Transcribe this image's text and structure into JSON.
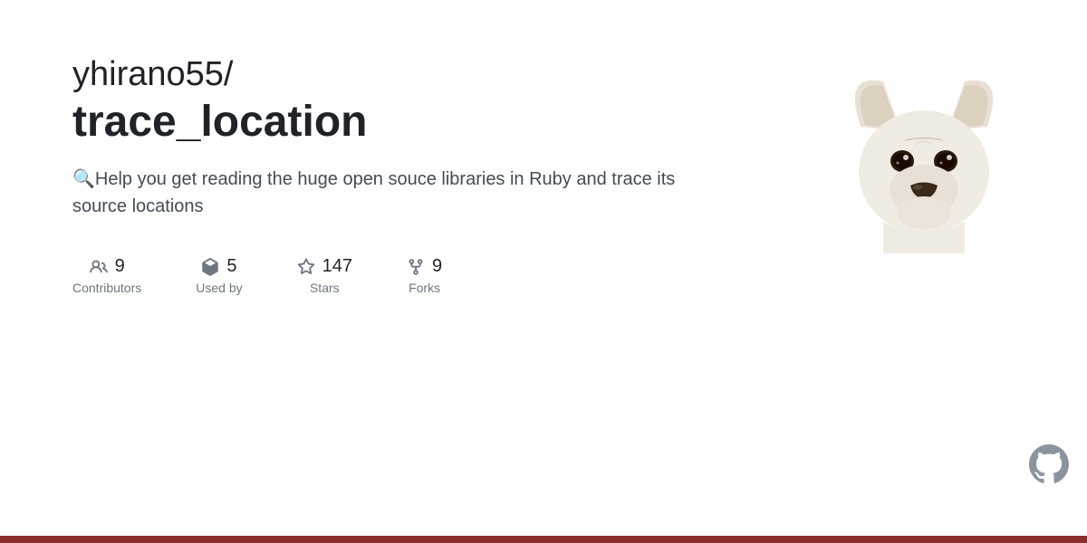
{
  "repo": {
    "owner": "yhirano55/",
    "name": "trace_location",
    "description": "🔍Help you get reading the huge open souce libraries in Ruby and trace its source locations"
  },
  "stats": [
    {
      "id": "contributors",
      "icon": "people-icon",
      "number": "9",
      "label": "Contributors"
    },
    {
      "id": "used-by",
      "icon": "package-icon",
      "number": "5",
      "label": "Used by"
    },
    {
      "id": "stars",
      "icon": "star-icon",
      "number": "147",
      "label": "Stars"
    },
    {
      "id": "forks",
      "icon": "fork-icon",
      "number": "9",
      "label": "Forks"
    }
  ],
  "bottom_bar_color": "#8b2e2e",
  "github_icon_label": "github-icon"
}
